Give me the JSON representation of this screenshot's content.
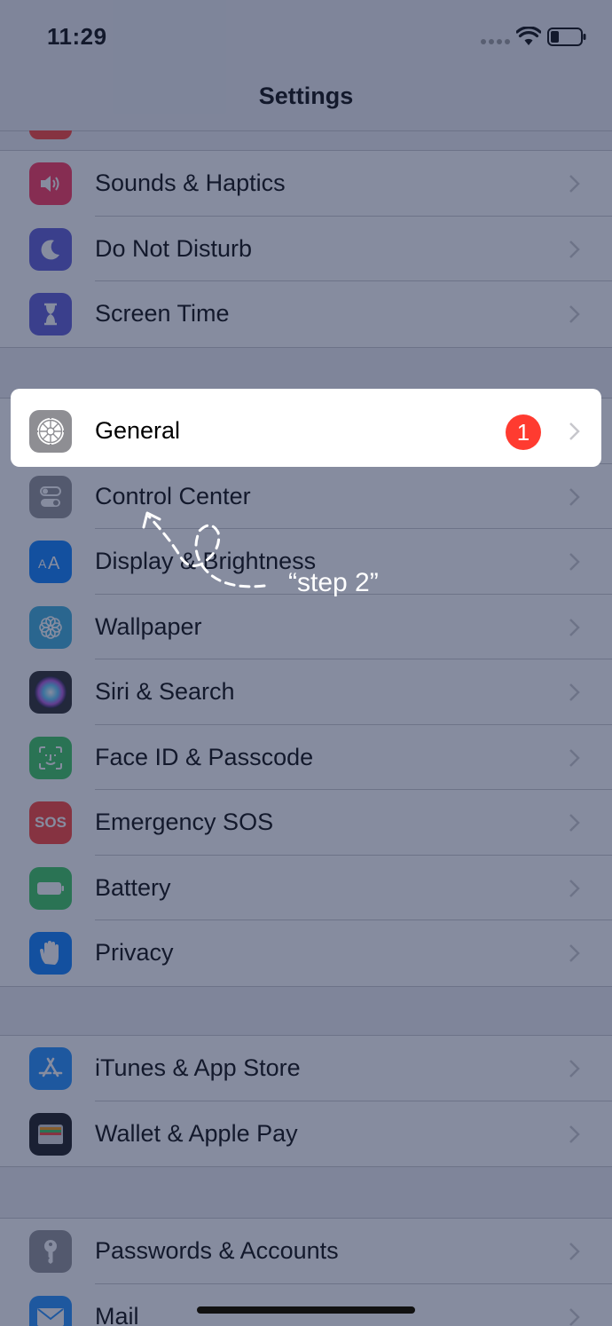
{
  "status_bar": {
    "time": "11:29"
  },
  "nav": {
    "title": "Settings"
  },
  "groups": [
    {
      "items": [
        {
          "label": "Sounds & Haptics",
          "icon": "speaker-icon",
          "color": "#ff2d55"
        },
        {
          "label": "Do Not Disturb",
          "icon": "moon-icon",
          "color": "#5856d6"
        },
        {
          "label": "Screen Time",
          "icon": "hourglass-icon",
          "color": "#5856d6"
        }
      ]
    },
    {
      "items": [
        {
          "label": "General",
          "icon": "gear-icon",
          "color": "#8e8e93",
          "badge": "1"
        },
        {
          "label": "Control Center",
          "icon": "toggles-icon",
          "color": "#8e8e93"
        },
        {
          "label": "Display & Brightness",
          "icon": "text-size-icon",
          "color": "#007aff"
        },
        {
          "label": "Wallpaper",
          "icon": "flower-icon",
          "color": "#34aadc"
        },
        {
          "label": "Siri & Search",
          "icon": "siri-icon",
          "color": "#222222"
        },
        {
          "label": "Face ID & Passcode",
          "icon": "face-id-icon",
          "color": "#34c759"
        },
        {
          "label": "Emergency SOS",
          "icon": "sos-icon",
          "color": "#ff3b30",
          "icon_text": "SOS"
        },
        {
          "label": "Battery",
          "icon": "battery-icon",
          "color": "#34c759"
        },
        {
          "label": "Privacy",
          "icon": "hand-icon",
          "color": "#007aff"
        }
      ]
    },
    {
      "items": [
        {
          "label": "iTunes & App Store",
          "icon": "app-store-icon",
          "color": "#1a8cff"
        },
        {
          "label": "Wallet & Apple Pay",
          "icon": "wallet-icon",
          "color": "#111111"
        }
      ]
    },
    {
      "items": [
        {
          "label": "Passwords & Accounts",
          "icon": "key-icon",
          "color": "#8e8e93"
        },
        {
          "label": "Mail",
          "icon": "mail-icon",
          "color": "#1a8cff"
        }
      ]
    }
  ],
  "annotation": {
    "text": "“step 2”"
  }
}
